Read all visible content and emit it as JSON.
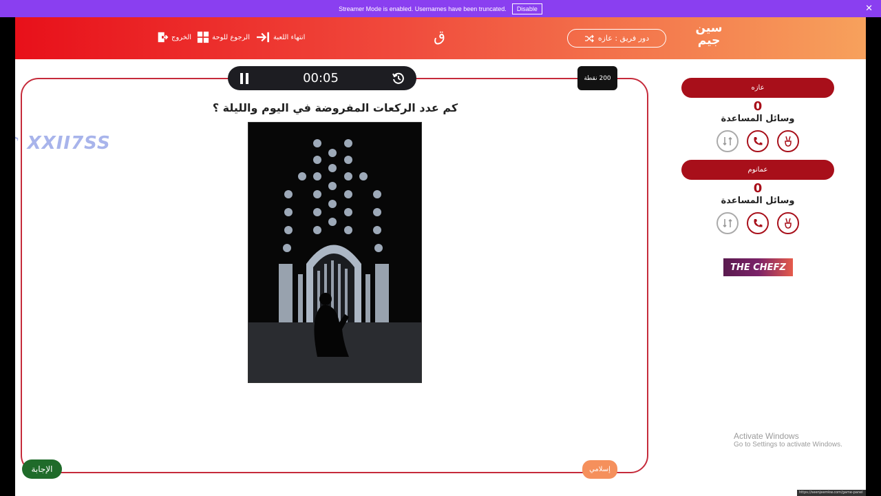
{
  "streamer": {
    "message": "Streamer Mode is enabled. Usernames have been truncated.",
    "disable_label": "Disable",
    "close_symbol": "✕"
  },
  "header": {
    "nav": [
      {
        "label": "الخروج",
        "icon": "exit-icon"
      },
      {
        "label": "الرجوع للوحة",
        "icon": "grid-icon"
      },
      {
        "label": "انتهاء اللعبة",
        "icon": "end-game-icon"
      }
    ],
    "letter": "ق",
    "team_turn": "دور فريق : عازه",
    "logo_line1": "سين",
    "logo_line2": "جيم"
  },
  "timer": {
    "time": "00:05",
    "pause_icon": "pause-icon",
    "reset_icon": "reset-icon"
  },
  "points": "200 نقطة",
  "question": "كم عدد الركعات المفروضة في اليوم والليلة ؟",
  "answer_label": "الإجابة",
  "category_label": "إسلامي",
  "watermark": "♪ XXII7SS",
  "teams": [
    {
      "name": "عازه",
      "score": "0",
      "helpers_label": "وسائل المساعدة"
    },
    {
      "name": "عمانوم",
      "score": "0",
      "helpers_label": "وسائل المساعدة"
    }
  ],
  "sponsor": "THE CHEFZ",
  "activate": {
    "title": "Activate Windows",
    "subtitle": "Go to Settings to activate Windows."
  },
  "status_url": "https://seenjeemkw.com/game-panel",
  "colors": {
    "streamer_bar": "#8a3ff0",
    "header_start": "#e8101a",
    "header_end": "#f7a15c",
    "team_red": "#a80f1a",
    "answer_green": "#1f6b2a",
    "category_orange": "#f5905c"
  }
}
